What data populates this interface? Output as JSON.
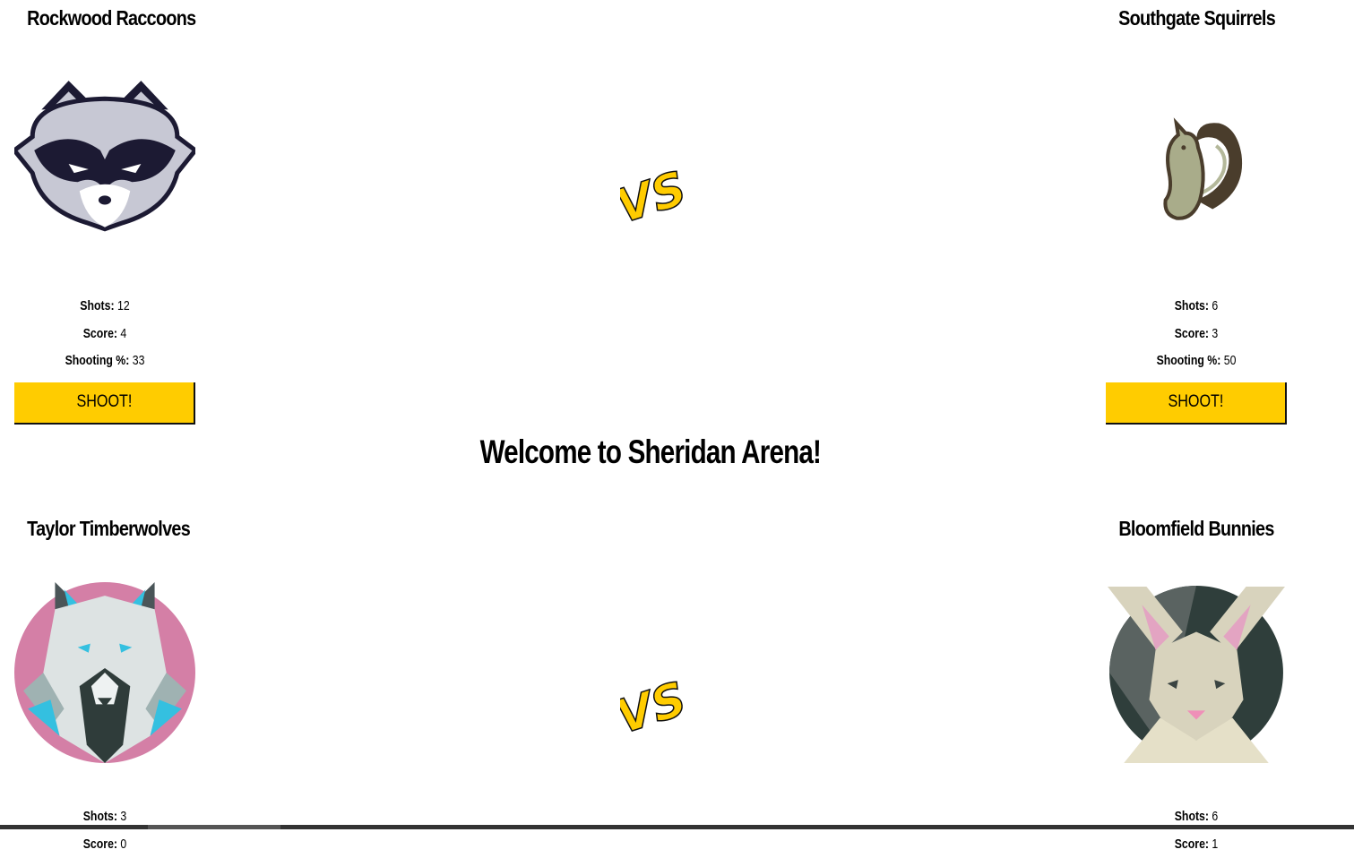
{
  "welcome": "Welcome to Sheridan Arena!",
  "vs_label": "VS",
  "labels": {
    "shots": "Shots:",
    "score": "Score:",
    "pct": "Shooting %:"
  },
  "teams": [
    {
      "name": "Rockwood Raccoons",
      "logo": "raccoon-icon",
      "shots": "12",
      "score": "4",
      "pct": "33",
      "button": "SHOOT!"
    },
    {
      "name": "Southgate Squirrels",
      "logo": "squirrel-icon",
      "shots": "6",
      "score": "3",
      "pct": "50",
      "button": "SHOOT!"
    },
    {
      "name": "Taylor Timberwolves",
      "logo": "wolf-icon",
      "shots": "3",
      "score": "0"
    },
    {
      "name": "Bloomfield Bunnies",
      "logo": "bunny-icon",
      "shots": "6",
      "score": "1"
    }
  ],
  "colors": {
    "button": "#ffcc00",
    "vs": "#ffcc00",
    "raccoon_mask": "#1c1a33",
    "wolf_bg": "#d47fa6",
    "bunny_bg": "#2f3e3b"
  }
}
